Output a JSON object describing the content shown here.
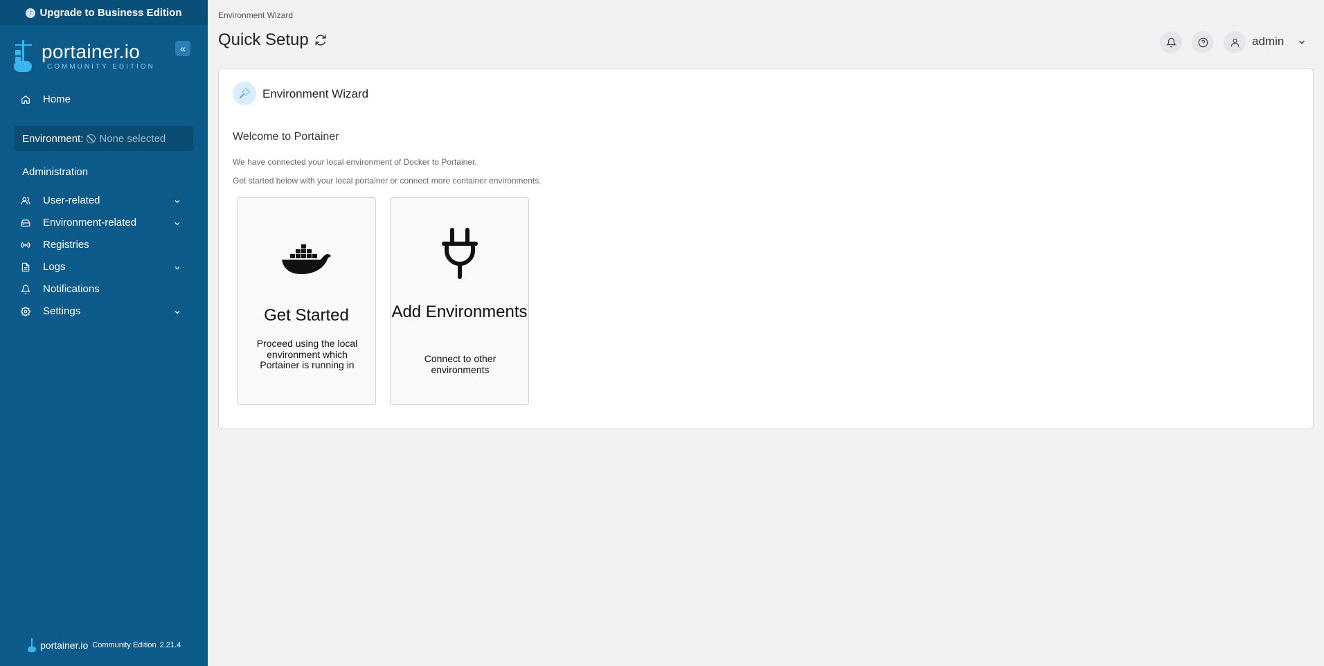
{
  "sidebar": {
    "upgrade_label": "Upgrade to Business Edition",
    "logo_name": "portainer.io",
    "logo_edition": "COMMUNITY EDITION",
    "home_label": "Home",
    "environment_label": "Environment:",
    "environment_value": "None selected",
    "section_title": "Administration",
    "items": [
      {
        "label": "User-related",
        "icon": "users-icon",
        "has_chevron": true
      },
      {
        "label": "Environment-related",
        "icon": "hard-drive-icon",
        "has_chevron": true
      },
      {
        "label": "Registries",
        "icon": "radio-icon",
        "has_chevron": false
      },
      {
        "label": "Logs",
        "icon": "file-text-icon",
        "has_chevron": true
      },
      {
        "label": "Notifications",
        "icon": "bell-icon",
        "has_chevron": false
      },
      {
        "label": "Settings",
        "icon": "gear-icon",
        "has_chevron": true
      }
    ],
    "footer": {
      "name": "portainer.io",
      "edition": "Community Edition",
      "version": "2.21.4"
    }
  },
  "header": {
    "breadcrumb": "Environment Wizard",
    "title": "Quick Setup",
    "username": "admin"
  },
  "panel": {
    "title": "Environment Wizard",
    "welcome": "Welcome to Portainer",
    "desc1": "We have connected your local environment of Docker to Portainer.",
    "desc2": "Get started below with your local portainer or connect more container environments.",
    "cards": [
      {
        "title": "Get Started",
        "desc": "Proceed using the local environment which Portainer is running in",
        "icon": "docker-whale-icon"
      },
      {
        "title": "Add Environments",
        "desc": "Connect to other environments",
        "icon": "plug-icon"
      }
    ]
  },
  "colors": {
    "sidebar": "#0b5a8a",
    "accent": "#3bb5f0",
    "background": "#f2f2f2"
  }
}
